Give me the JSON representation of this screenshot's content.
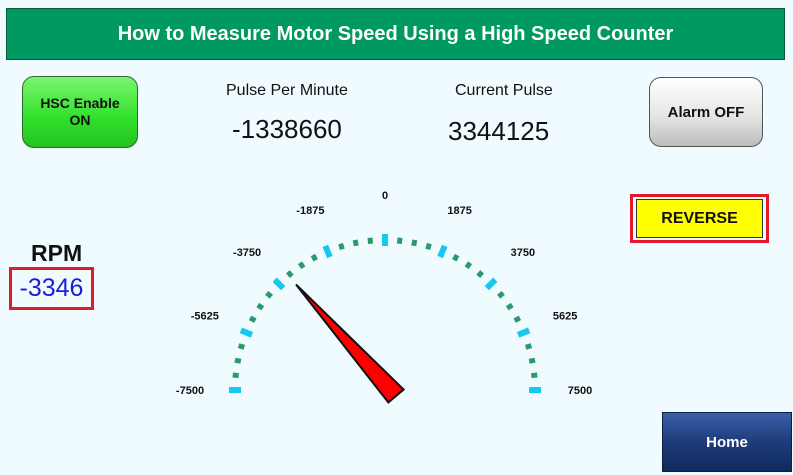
{
  "header": {
    "title": "How to Measure Motor Speed Using a High Speed Counter"
  },
  "buttons": {
    "hsc_enable": "HSC Enable\nON",
    "alarm": "Alarm OFF",
    "reverse": "REVERSE",
    "home": "Home"
  },
  "readouts": {
    "pulse_per_minute_label": "Pulse Per Minute",
    "pulse_per_minute_value": "-1338660",
    "current_pulse_label": "Current Pulse",
    "current_pulse_value": "3344125"
  },
  "rpm": {
    "label": "RPM",
    "value": "-3346"
  },
  "gauge": {
    "min": -7500,
    "max": 7500,
    "value": -3346,
    "tick_labels": [
      "-7500",
      "-5625",
      "-3750",
      "-1875",
      "0",
      "1875",
      "3750",
      "5625",
      "7500"
    ],
    "colors": {
      "minor_tick": "#2a9a6e",
      "major_tick": "#14c8f0",
      "needle": "#ff0000",
      "needle_outline": "#111111"
    }
  },
  "colors": {
    "title_bar": "#019962",
    "hsc_button": "#2fe02a",
    "reverse_button": "#ffff00",
    "highlight_frame": "#e01a2a",
    "rpm_value": "#1c1cd8",
    "home_button": "#1d3c7a"
  }
}
